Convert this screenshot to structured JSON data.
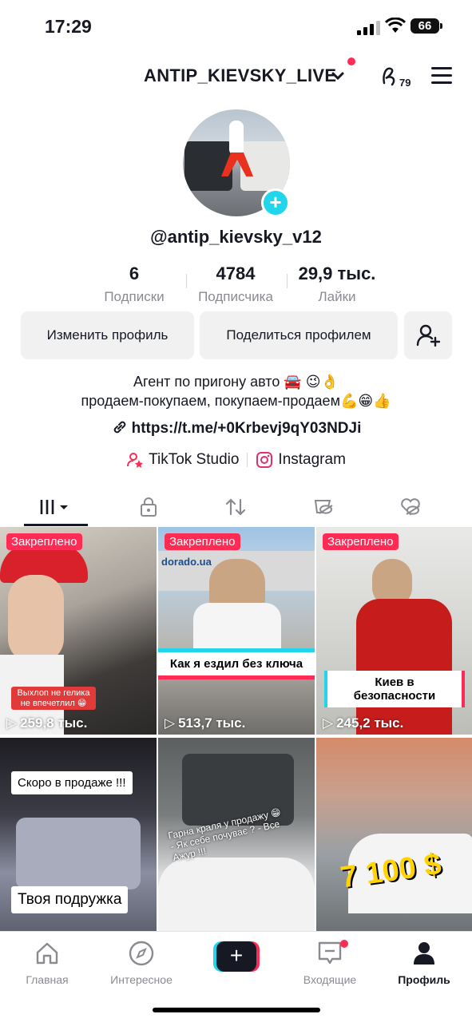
{
  "status": {
    "time": "17:29",
    "battery": "66"
  },
  "header": {
    "username": "ANTIP_KIEVSKY_LIVE",
    "creator_count": "79"
  },
  "profile": {
    "handle": "@antip_kievsky_v12"
  },
  "stats": [
    {
      "value": "6",
      "label": "Подписки"
    },
    {
      "value": "4784",
      "label": "Подписчика"
    },
    {
      "value": "29,9 тыс.",
      "label": "Лайки"
    }
  ],
  "buttons": {
    "edit": "Изменить профиль",
    "share": "Поделиться профилем"
  },
  "bio": {
    "line1": "Агент по пригону авто 🚘 😉👌",
    "line2": "продаем-покупаем, покупаем-продаем💪😁👍",
    "link": "https://t.me/+0Krbevj9qY03NDJi"
  },
  "badges": {
    "studio": "TikTok Studio",
    "instagram": "Instagram"
  },
  "videos": [
    {
      "pinned": "Закреплено",
      "views": "259,8 тыс.",
      "caption": "Выхлоп не гелика не впечетлил 😁"
    },
    {
      "pinned": "Закреплено",
      "views": "513,7 тыс.",
      "caption": "Как я ездил без ключа",
      "sign": "dorado.ua"
    },
    {
      "pinned": "Закреплено",
      "views": "245,2 тыс.",
      "caption": "Киев в безопасности"
    },
    {
      "views": "",
      "caption": "Скоро в продаже !!!",
      "caption2": "Твоя подружка"
    },
    {
      "views": "",
      "caption": "Гарна краля у продажу 😁 - Як себе почуває ? - Все Ажур !!!"
    },
    {
      "views": "",
      "caption": "7 100 $"
    }
  ],
  "nav": [
    {
      "label": "Главная",
      "icon": "home-icon"
    },
    {
      "label": "Интересное",
      "icon": "compass-icon"
    },
    {
      "label": "",
      "icon": "plus-icon"
    },
    {
      "label": "Входящие",
      "icon": "inbox-icon"
    },
    {
      "label": "Профиль",
      "icon": "profile-icon"
    }
  ],
  "colors": {
    "accent": "#fe2c55",
    "cyan": "#20d5ec",
    "text": "#161823",
    "muted": "#8a8b91"
  }
}
